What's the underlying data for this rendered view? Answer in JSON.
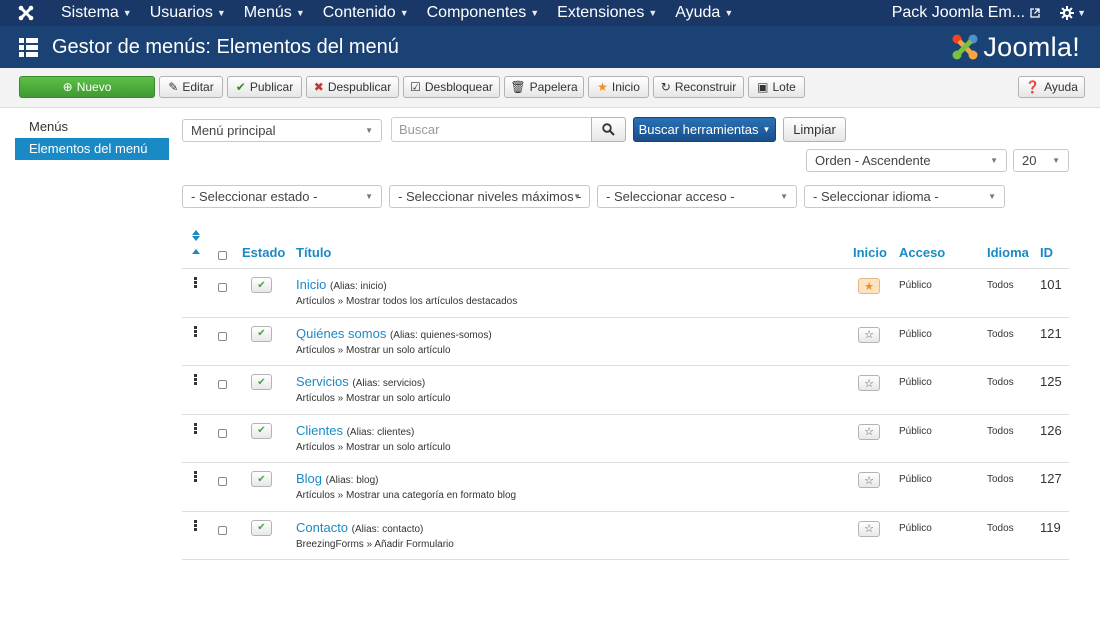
{
  "topnav": {
    "menu": [
      {
        "id": "sistema",
        "label": "Sistema"
      },
      {
        "id": "usuarios",
        "label": "Usuarios"
      },
      {
        "id": "menus",
        "label": "Menús"
      },
      {
        "id": "contenido",
        "label": "Contenido"
      },
      {
        "id": "componentes",
        "label": "Componentes"
      },
      {
        "id": "extensiones",
        "label": "Extensiones"
      },
      {
        "id": "ayuda",
        "label": "Ayuda"
      }
    ],
    "site_label": "Pack Joomla Em...",
    "icons": {
      "logo": "joomla-logo-icon",
      "external": "external-link-icon",
      "settings": "gear-icon"
    }
  },
  "header": {
    "title": "Gestor de menús: Elementos del menú",
    "brand": "Joomla!"
  },
  "toolbar": {
    "nuevo": "Nuevo",
    "editar": "Editar",
    "publicar": "Publicar",
    "despublicar": "Despublicar",
    "desbloquear": "Desbloquear",
    "papelera": "Papelera",
    "inicio": "Inicio",
    "reconstruir": "Reconstruir",
    "lote": "Lote",
    "ayuda": "Ayuda"
  },
  "sidebar": {
    "items": [
      {
        "label": "Menús",
        "active": false
      },
      {
        "label": "Elementos del menú",
        "active": true
      }
    ]
  },
  "filters": {
    "menu_select": "Menú principal",
    "search_placeholder": "Buscar",
    "search_tools": "Buscar herramientas",
    "clear": "Limpiar",
    "ordering": "Orden - Ascendente",
    "limit": "20",
    "estado": "- Seleccionar estado -",
    "niveles": "- Seleccionar niveles máximos -",
    "acceso": "- Seleccionar acceso -",
    "idioma": "- Seleccionar idioma -"
  },
  "table": {
    "headers": {
      "estado": "Estado",
      "titulo": "Título",
      "inicio": "Inicio",
      "acceso": "Acceso",
      "idioma": "Idioma",
      "id": "ID"
    },
    "rows": [
      {
        "title": "Inicio",
        "alias": "(Alias: inicio)",
        "subtitle": "Artículos » Mostrar todos los artículos destacados",
        "home": true,
        "access": "Público",
        "language": "Todos",
        "id": "101"
      },
      {
        "title": "Quiénes somos",
        "alias": "(Alias: quienes-somos)",
        "subtitle": "Artículos » Mostrar un solo artículo",
        "home": false,
        "access": "Público",
        "language": "Todos",
        "id": "121"
      },
      {
        "title": "Servicios",
        "alias": "(Alias: servicios)",
        "subtitle": "Artículos » Mostrar un solo artículo",
        "home": false,
        "access": "Público",
        "language": "Todos",
        "id": "125"
      },
      {
        "title": "Clientes",
        "alias": "(Alias: clientes)",
        "subtitle": "Artículos » Mostrar un solo artículo",
        "home": false,
        "access": "Público",
        "language": "Todos",
        "id": "126"
      },
      {
        "title": "Blog",
        "alias": "(Alias: blog)",
        "subtitle": "Artículos » Mostrar una categoría en formato blog",
        "home": false,
        "access": "Público",
        "language": "Todos",
        "id": "127"
      },
      {
        "title": "Contacto",
        "alias": "(Alias: contacto)",
        "subtitle": "BreezingForms » Añadir Formulario",
        "home": false,
        "access": "Público",
        "language": "Todos",
        "id": "119"
      }
    ]
  },
  "colors": {
    "topnav": "#1a3867",
    "header": "#1b4275",
    "accent": "#1a8ac6",
    "success": "#46a546",
    "home_star": "#f09020"
  }
}
